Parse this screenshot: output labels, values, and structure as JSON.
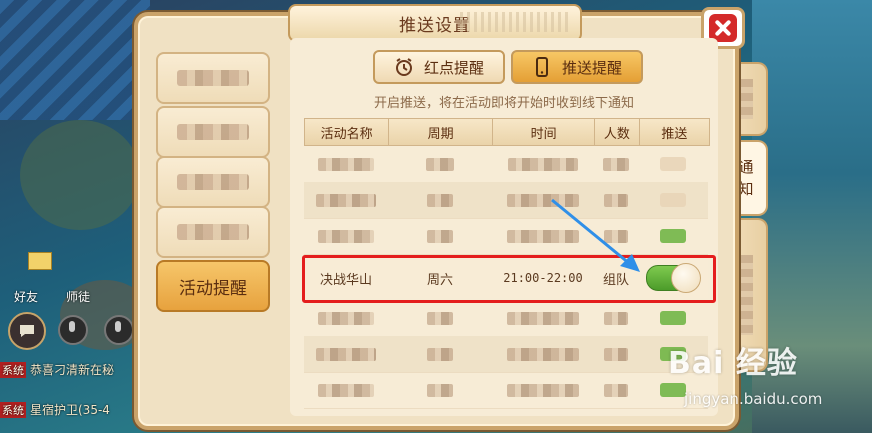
{
  "panel": {
    "title": "推送设置"
  },
  "nav": {
    "active_label": "活动提醒"
  },
  "tabs": {
    "red_dot": "红点提醒",
    "push": "推送提醒",
    "active": "推送提醒"
  },
  "hint": "开启推送，将在活动即将开始时收到线下通知",
  "table": {
    "headers": [
      "活动名称",
      "周期",
      "时间",
      "人数",
      "推送"
    ],
    "highlighted_row": {
      "name": "决战华山",
      "period": "周六",
      "time": "21:00-22:00",
      "players": "组队",
      "push_enabled": true
    }
  },
  "side_tabs": {
    "notice": "通知"
  },
  "hud": {
    "friends": "好友",
    "mentor": "师徒"
  },
  "chat": [
    {
      "tag": "系统",
      "text": "恭喜刁清新在秘"
    },
    {
      "tag": "系统",
      "text": "星宿护卫(35-4"
    }
  ],
  "watermark": {
    "logo": "Bai 经验",
    "url": "jingyan.baidu.com"
  },
  "colors": {
    "highlight_box": "#e41d1d",
    "toggle_on": "#5fae36",
    "arrow": "#2f8fe8"
  },
  "icons": [
    "close-icon",
    "alarm-clock-icon",
    "phone-icon",
    "chat-bubble-icon",
    "microphone-icon"
  ]
}
